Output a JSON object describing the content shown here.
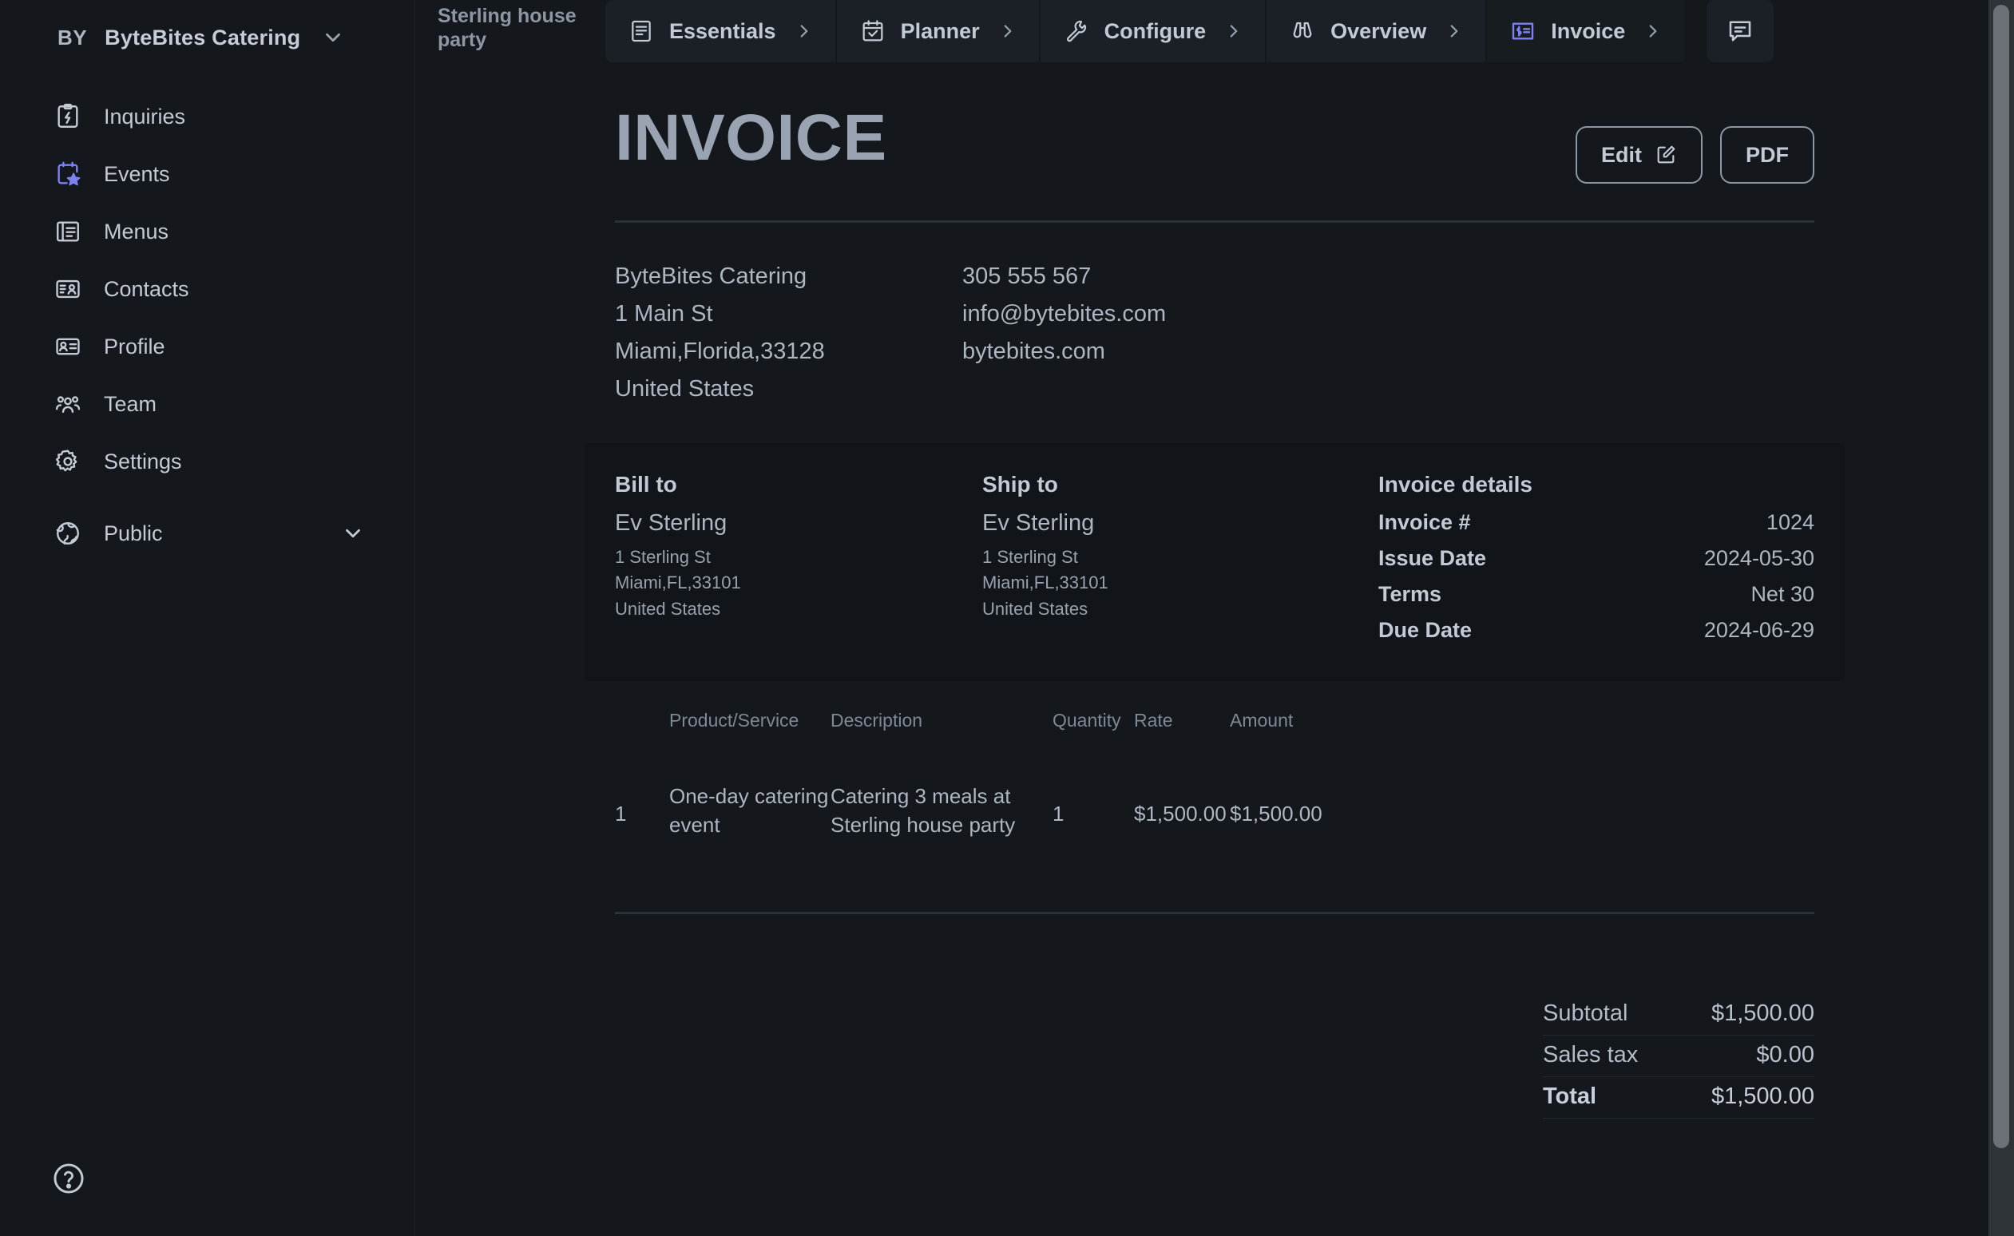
{
  "theme": {
    "bg": "#14181d",
    "panel": "#11151a",
    "accent": "#7d81f2",
    "text": "#c3cad5",
    "muted": "#8e96a3"
  },
  "sidebar": {
    "brand": {
      "initials": "BY",
      "name": "ByteBites Catering",
      "chevron_icon": "chevron-down-icon"
    },
    "items": [
      {
        "label": "Inquiries",
        "icon": "clipboard-bolt-icon",
        "active": false
      },
      {
        "label": "Events",
        "icon": "calendar-star-icon",
        "active": true
      },
      {
        "label": "Menus",
        "icon": "book-menu-icon",
        "active": false
      },
      {
        "label": "Contacts",
        "icon": "contact-card-icon",
        "active": false
      },
      {
        "label": "Profile",
        "icon": "id-badge-icon",
        "active": false
      },
      {
        "label": "Team",
        "icon": "users-group-icon",
        "active": false
      },
      {
        "label": "Settings",
        "icon": "gear-icon",
        "active": false
      }
    ],
    "public_item": {
      "label": "Public",
      "icon": "globe-icon",
      "chevron_icon": "chevron-down-icon"
    },
    "help": {
      "icon": "help-circle-icon",
      "label": "Help"
    }
  },
  "topbar": {
    "event_title": "Sterling house party",
    "tabs": [
      {
        "label": "Essentials",
        "icon": "document-lines-icon",
        "chevron": "chevron-right-icon",
        "active": false
      },
      {
        "label": "Planner",
        "icon": "calendar-check-icon",
        "chevron": "chevron-right-icon",
        "active": false
      },
      {
        "label": "Configure",
        "icon": "wrench-icon",
        "chevron": "chevron-right-icon",
        "active": false
      },
      {
        "label": "Overview",
        "icon": "binoculars-icon",
        "chevron": "chevron-right-icon",
        "active": false
      },
      {
        "label": "Invoice",
        "icon": "invoice-dollar-icon",
        "chevron": "chevron-right-icon",
        "active": true
      }
    ],
    "chat_button": {
      "icon": "chat-bubble-icon",
      "label": "Messages"
    }
  },
  "invoice": {
    "title": "INVOICE",
    "actions": {
      "edit_label": "Edit",
      "edit_icon": "pencil-square-icon",
      "pdf_label": "PDF"
    },
    "company": {
      "left": [
        "ByteBites Catering",
        "1 Main St",
        "Miami,Florida,33128",
        "United States"
      ],
      "right": [
        "305 555 567",
        "info@bytebites.com",
        "bytebites.com"
      ]
    },
    "bill_to": {
      "heading": "Bill to",
      "name": "Ev Sterling",
      "lines": [
        "1 Sterling St",
        "Miami,FL,33101",
        "United States"
      ]
    },
    "ship_to": {
      "heading": "Ship to",
      "name": "Ev Sterling",
      "lines": [
        "1 Sterling St",
        "Miami,FL,33101",
        "United States"
      ]
    },
    "details": {
      "heading": "Invoice details",
      "rows": [
        {
          "key": "Invoice #",
          "value": "1024"
        },
        {
          "key": "Issue Date",
          "value": "2024-05-30"
        },
        {
          "key": "Terms",
          "value": "Net 30"
        },
        {
          "key": "Due Date",
          "value": "2024-06-29"
        }
      ]
    },
    "table": {
      "columns": [
        "",
        "Product/Service",
        "Description",
        "Quantity",
        "Rate",
        "Amount"
      ],
      "rows": [
        {
          "index": "1",
          "product": "One-day catering event",
          "description": "Catering 3 meals at Sterling house party",
          "quantity": "1",
          "rate": "$1,500.00",
          "amount": "$1,500.00"
        }
      ]
    },
    "totals": [
      {
        "label": "Subtotal",
        "value": "$1,500.00",
        "bold": false
      },
      {
        "label": "Sales tax",
        "value": "$0.00",
        "bold": false
      },
      {
        "label": "Total",
        "value": "$1,500.00",
        "bold": true
      }
    ]
  }
}
